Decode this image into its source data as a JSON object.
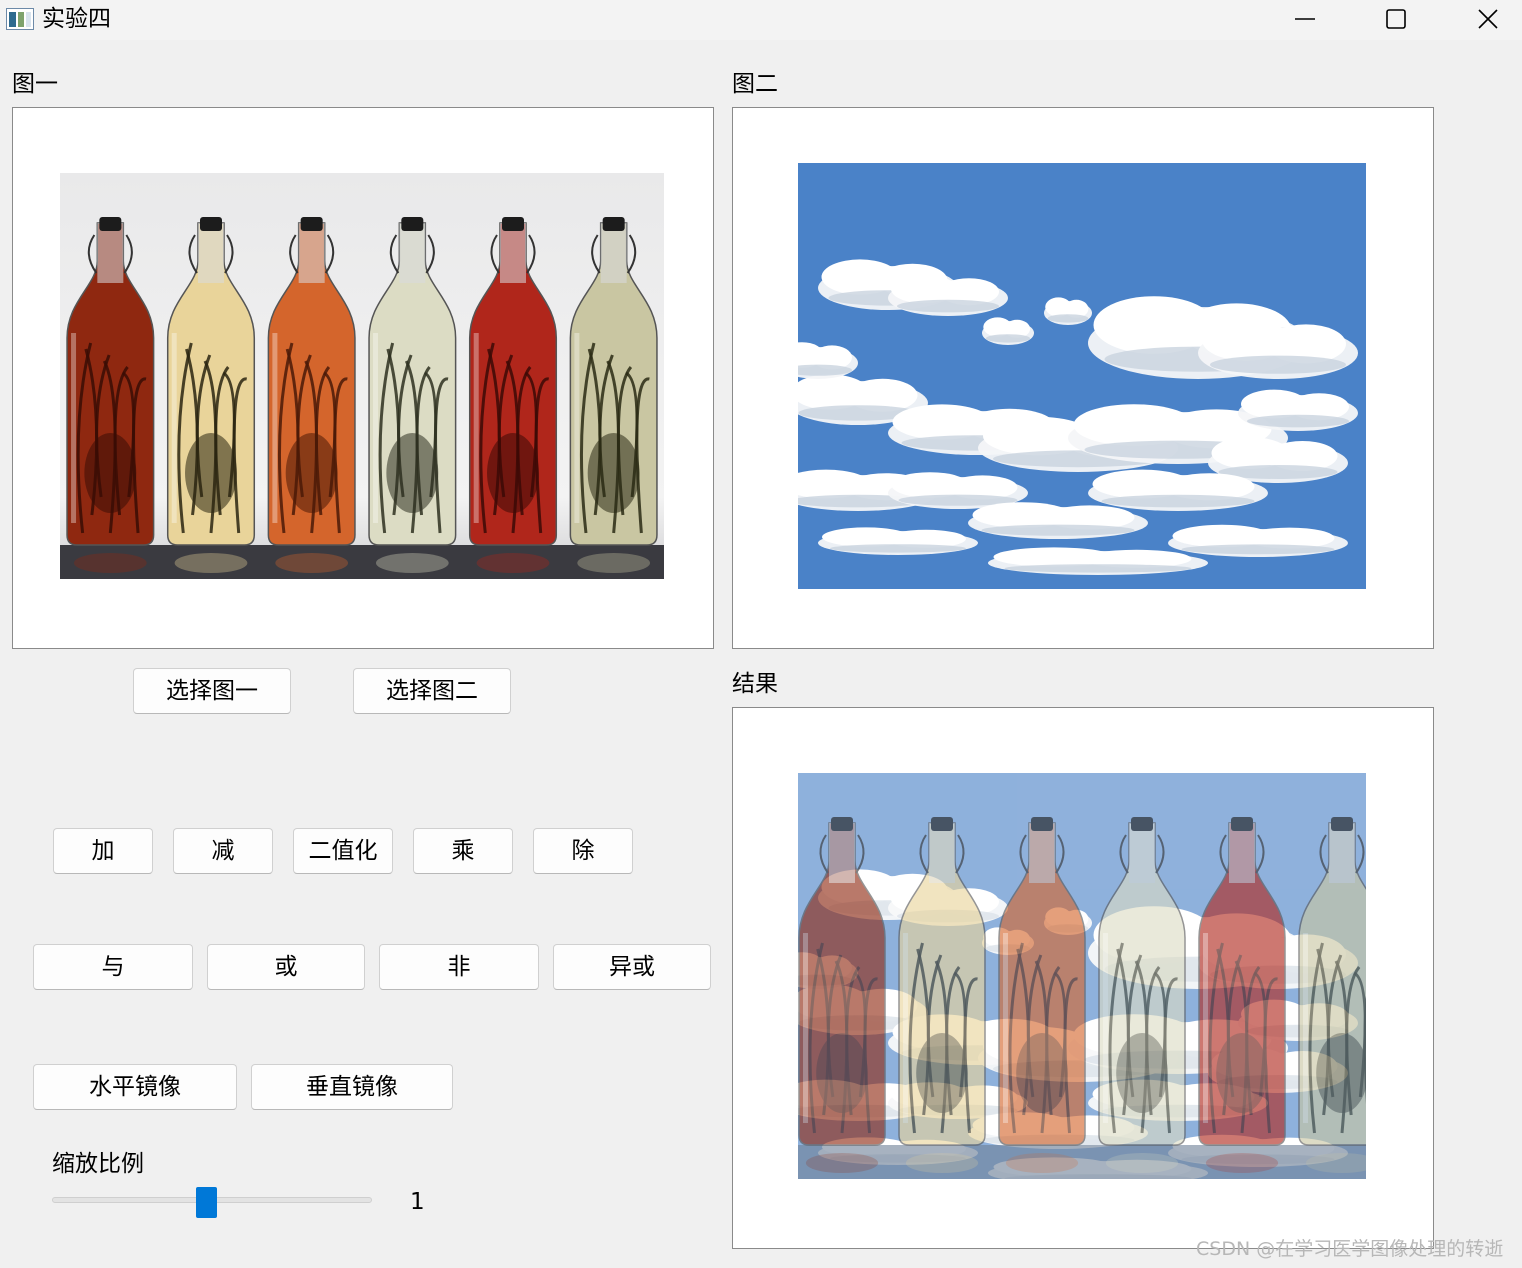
{
  "window": {
    "title": "实验四"
  },
  "labels": {
    "image1": "图一",
    "image2": "图二",
    "result": "结果",
    "scale": "缩放比例"
  },
  "buttons": {
    "select_image1": "选择图一",
    "select_image2": "选择图二",
    "add": "加",
    "subtract": "减",
    "binarize": "二值化",
    "multiply": "乘",
    "divide": "除",
    "and": "与",
    "or": "或",
    "not": "非",
    "xor": "异或",
    "mirror_horizontal": "水平镜像",
    "mirror_vertical": "垂直镜像"
  },
  "slider": {
    "value_text": "1",
    "level_fraction": 0.48
  },
  "watermark": "CSDN @在学习医学图像处理的转逝",
  "bottles": [
    {
      "liquid": "#8f2810",
      "dark": "#3a0d05"
    },
    {
      "liquid": "#e9d49a",
      "dark": "#2a2410"
    },
    {
      "liquid": "#d4652c",
      "dark": "#4a1a08"
    },
    {
      "liquid": "#dcdcc4",
      "dark": "#2e3020"
    },
    {
      "liquid": "#b0261b",
      "dark": "#3c0a06"
    },
    {
      "liquid": "#c9c6a2",
      "dark": "#2a2a14"
    }
  ],
  "colors": {
    "sky": "#4a82c8",
    "cloud": "#f4f6f8",
    "accent": "#0078d7"
  }
}
